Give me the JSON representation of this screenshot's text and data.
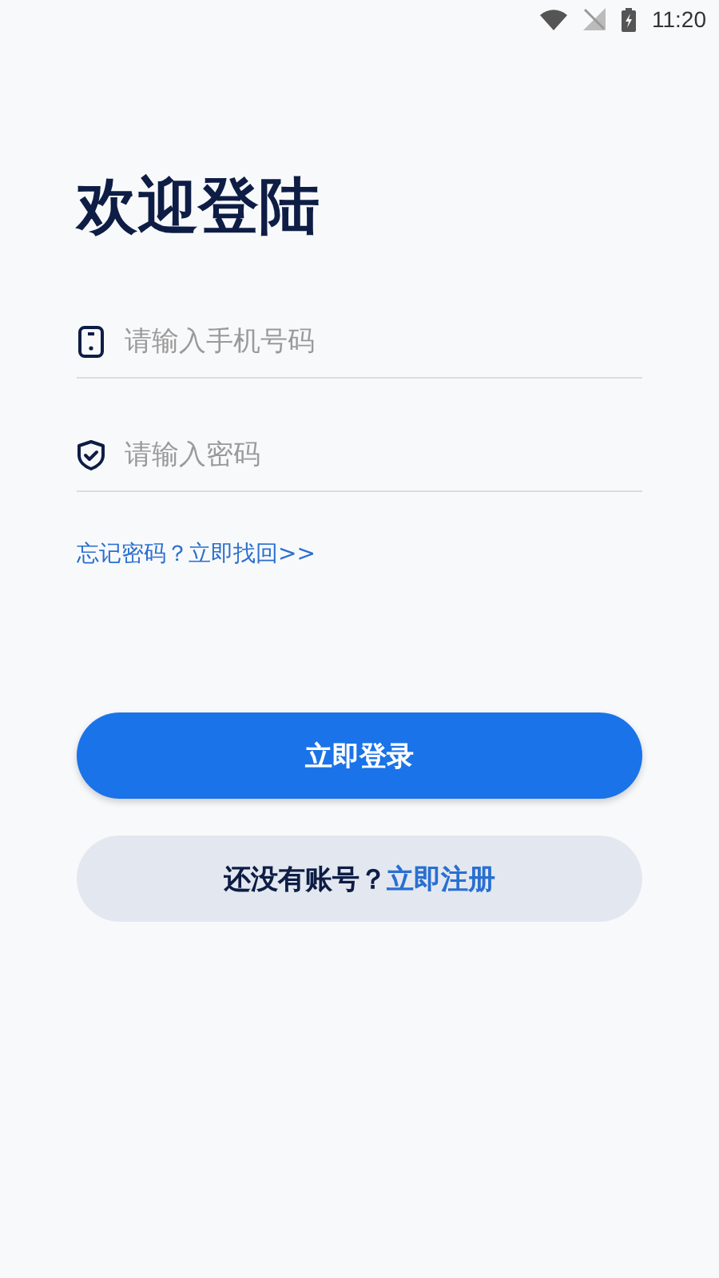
{
  "status_bar": {
    "time": "11:20"
  },
  "title": "欢迎登陆",
  "fields": [
    {
      "kind": "phone",
      "placeholder": "请输入手机号码"
    },
    {
      "kind": "password",
      "placeholder": "请输入密码"
    }
  ],
  "forgot_link": "忘记密码？立即找回>>",
  "login_button": "立即登录",
  "register": {
    "prompt": "还没有账号？",
    "link": "立即注册"
  }
}
